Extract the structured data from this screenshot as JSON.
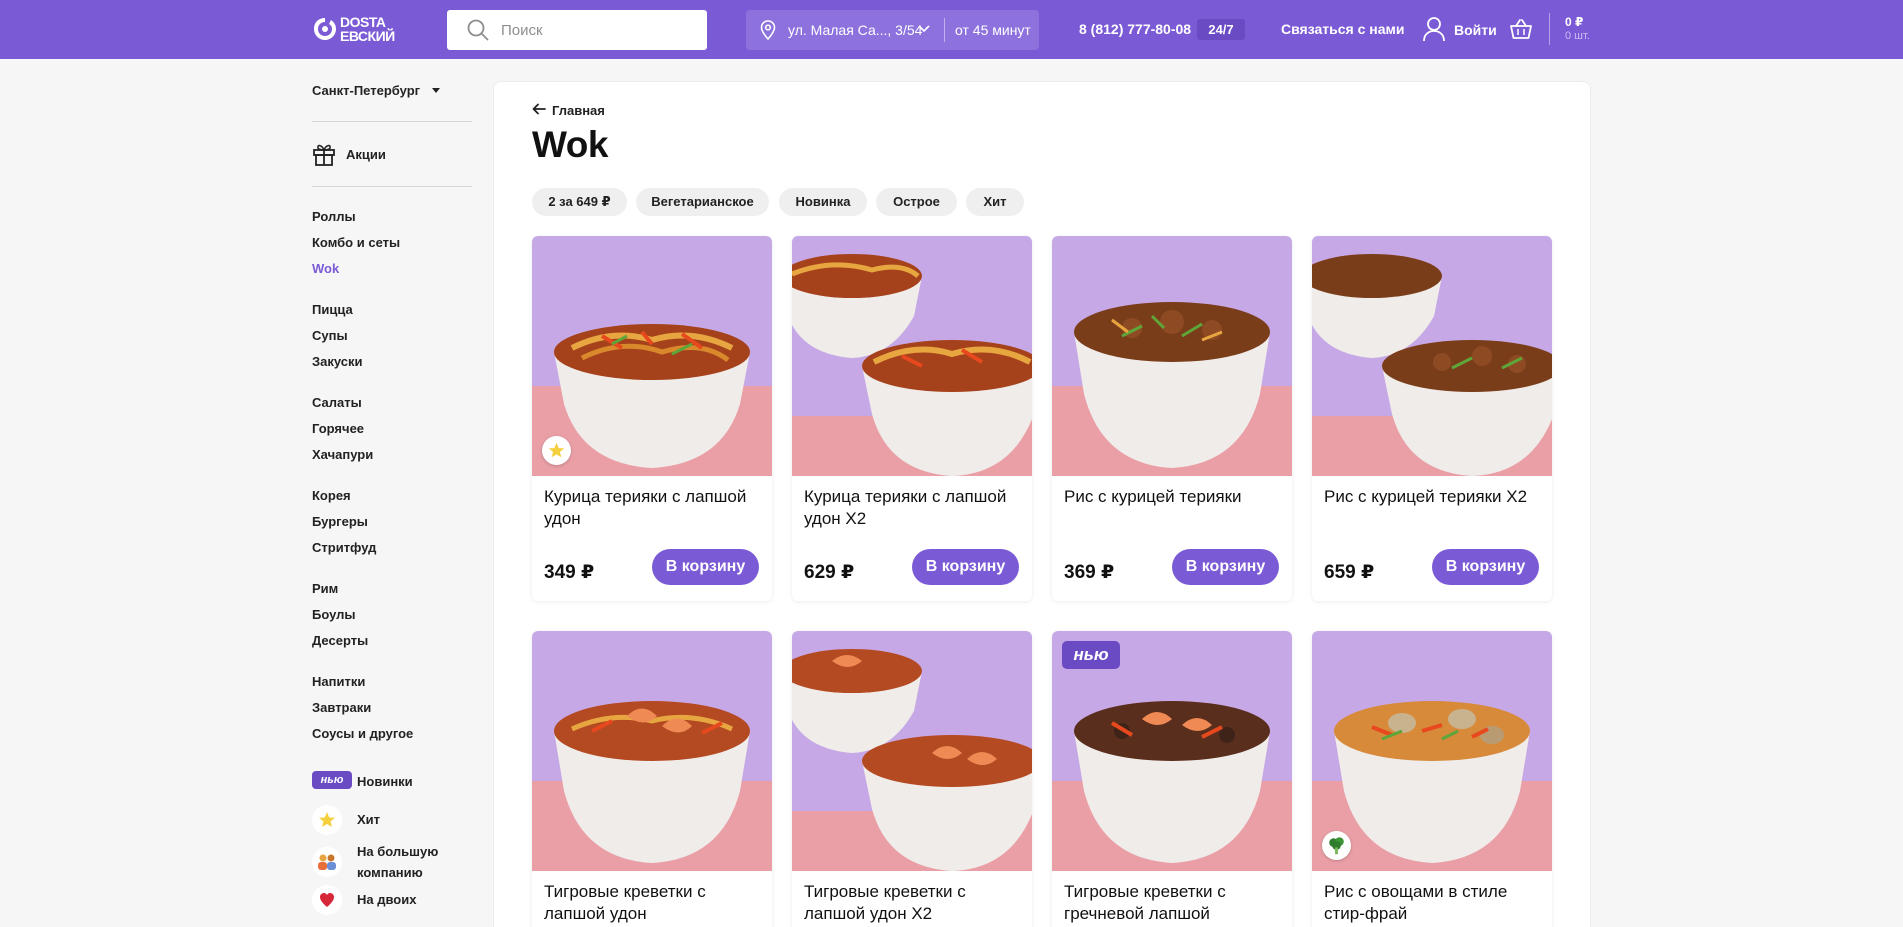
{
  "header": {
    "logo_text": "DOSTA\nЕВСКИЙ",
    "search_placeholder": "Поиск",
    "address": "ул. Малая Са..., 3/54",
    "delivery_time": "от 45 минут",
    "phone": "8 (812) 777-80-08",
    "hours": "24/7",
    "contact": "Связаться с нами",
    "login": "Войти",
    "cart_sum": "0 ₽",
    "cart_count": "0 шт."
  },
  "sidebar": {
    "city": "Санкт-Петербург",
    "promo": "Акции",
    "groups": [
      [
        "Роллы",
        "Комбо и сеты",
        "Wok"
      ],
      [
        "Пицца",
        "Супы",
        "Закуски"
      ],
      [
        "Салаты",
        "Горячее",
        "Хачапури"
      ],
      [
        "Корея",
        "Бургеры",
        "Стритфуд"
      ],
      [
        "Рим",
        "Боулы",
        "Десерты"
      ],
      [
        "Напитки",
        "Завтраки",
        "Соусы и другое"
      ]
    ],
    "active": "Wok",
    "new_badge": "нью",
    "tags": [
      "Новинки",
      "Хит",
      "На большую компанию",
      "На двоих"
    ]
  },
  "main": {
    "back": "Главная",
    "title": "Wok",
    "chips": [
      "2 за 649 ₽",
      "Вегетарианское",
      "Новинка",
      "Острое",
      "Хит"
    ],
    "buy_label": "В корзину",
    "new_tag": "нью",
    "products": [
      {
        "name": "Курица терияки с лапшой удон",
        "price": "349 ₽",
        "badge": "hit"
      },
      {
        "name": "Курица терияки с лапшой удон Х2",
        "price": "629 ₽",
        "badge": ""
      },
      {
        "name": "Рис с курицей терияки",
        "price": "369 ₽",
        "badge": ""
      },
      {
        "name": "Рис с курицей терияки Х2",
        "price": "659 ₽",
        "badge": ""
      },
      {
        "name": "Тигровые креветки с лапшой удон",
        "price": "",
        "badge": ""
      },
      {
        "name": "Тигровые креветки с лапшой удон Х2",
        "price": "",
        "badge": ""
      },
      {
        "name": "Тигровые креветки с гречневой лапшой",
        "price": "",
        "badge": "new"
      },
      {
        "name": "Рис с овощами в стиле стир-фрай",
        "price": "",
        "badge": "veg"
      }
    ]
  },
  "colors": {
    "brand": "#7b5ad6",
    "brand_dark": "#6a4bc4"
  },
  "icons": [
    "logo-icon",
    "search-icon",
    "location-pin-icon",
    "chevron-down-icon",
    "user-icon",
    "basket-icon",
    "gift-icon",
    "arrow-left-icon",
    "star-icon",
    "people-icon",
    "heart-icon",
    "broccoli-icon"
  ]
}
